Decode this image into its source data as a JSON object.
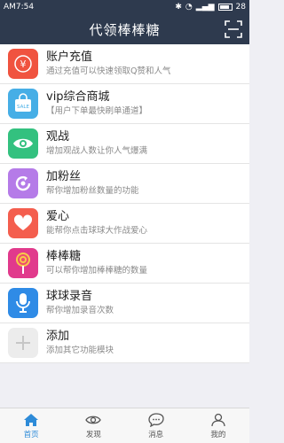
{
  "status_bar": {
    "time": "AM7:54",
    "battery": "28"
  },
  "header": {
    "title": "代领棒棒糖"
  },
  "menu": [
    {
      "name": "账户充值",
      "desc": "通过充值可以快速领取Q赞和人气",
      "icon": "yen-icon",
      "color": "#f0533f"
    },
    {
      "name": "vip综合商城",
      "desc": "【用户下单最快刷单通道】",
      "icon": "shopping-bag-icon",
      "color": "#46aee6",
      "icon_text": "SALE"
    },
    {
      "name": "观战",
      "desc": "增加观战人数让你人气爆满",
      "icon": "eye-icon",
      "color": "#33c17f"
    },
    {
      "name": "加粉丝",
      "desc": "帮你增加粉丝数量的功能",
      "icon": "refresh-icon",
      "color": "#b57be8"
    },
    {
      "name": "爱心",
      "desc": "能帮你点击球球大作战爱心",
      "icon": "heart-icon",
      "color": "#f45e4e"
    },
    {
      "name": "棒棒糖",
      "desc": "可以帮你增加棒棒糖的数量",
      "icon": "lollipop-icon",
      "color": "#e13a8c"
    },
    {
      "name": "球球录音",
      "desc": "帮你增加录音次数",
      "icon": "microphone-icon",
      "color": "#2f8be6"
    },
    {
      "name": "添加",
      "desc": "添加其它功能模块",
      "icon": "plus-icon",
      "color": "#e6e6e6"
    }
  ],
  "tabs": [
    {
      "label": "首页",
      "icon": "home-icon",
      "active": true
    },
    {
      "label": "发现",
      "icon": "discover-eye-icon",
      "active": false
    },
    {
      "label": "消息",
      "icon": "message-icon",
      "active": false
    },
    {
      "label": "我的",
      "icon": "user-icon",
      "active": false
    }
  ],
  "colors": {
    "header_bg": "#2e3a4e",
    "accent": "#2e8bd8"
  }
}
